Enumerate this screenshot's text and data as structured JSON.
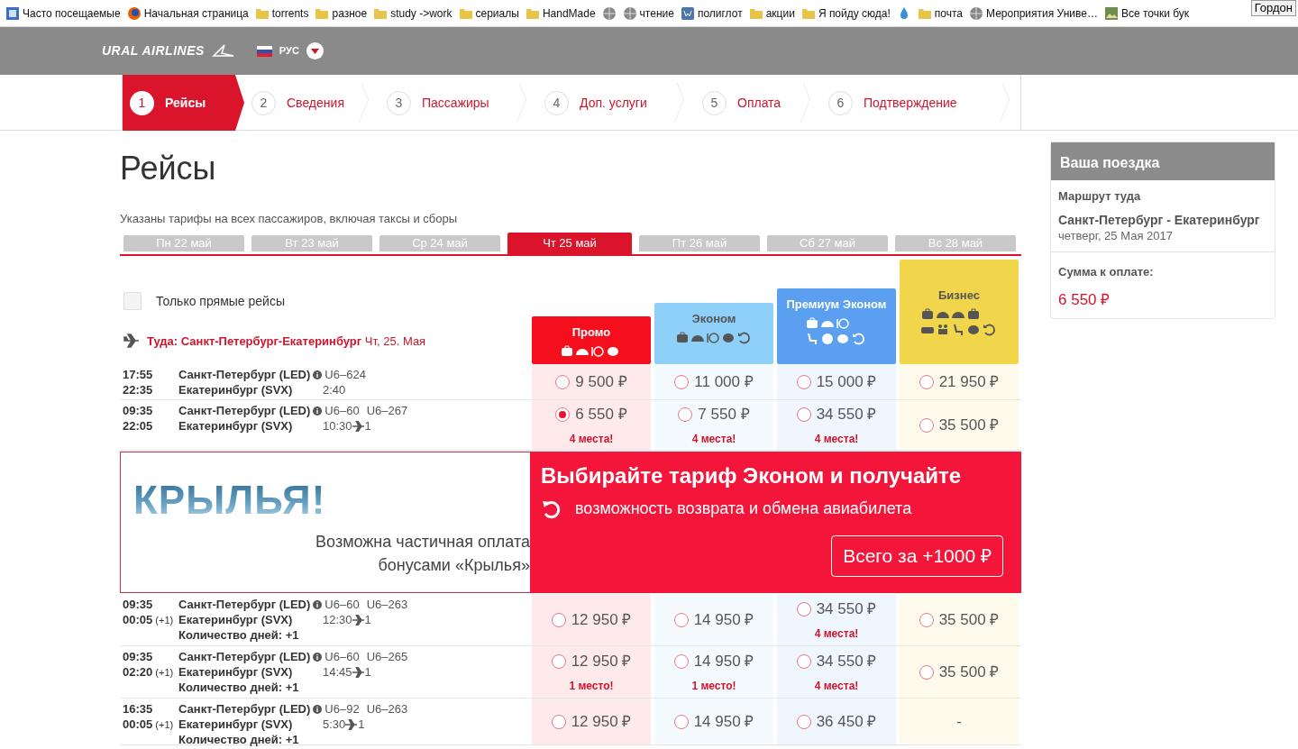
{
  "bookmarks": [
    {
      "kind": "page",
      "label": "Часто посещаемые"
    },
    {
      "kind": "firefox",
      "label": "Начальная страница"
    },
    {
      "kind": "folder",
      "label": "torrents"
    },
    {
      "kind": "folder",
      "label": "разное"
    },
    {
      "kind": "folder",
      "label": "study ->work"
    },
    {
      "kind": "folder",
      "label": "сериалы"
    },
    {
      "kind": "folder",
      "label": "HandMade"
    },
    {
      "kind": "globe"
    },
    {
      "kind": "globe",
      "label": "чтение"
    },
    {
      "kind": "vk",
      "label": "полиглот"
    },
    {
      "kind": "folder",
      "label": "акции"
    },
    {
      "kind": "folder",
      "label": "Я пойду сюда!"
    },
    {
      "kind": "drop"
    },
    {
      "kind": "folder",
      "label": "почта"
    },
    {
      "kind": "globe",
      "label": "Мероприятия Униве…"
    },
    {
      "kind": "image",
      "label": "Все точки бук"
    }
  ],
  "tooltip": "Гордон",
  "header": {
    "logo": "URAL AIRLINES",
    "language": "РУС"
  },
  "steps": [
    {
      "number": "1",
      "label": "Рейсы",
      "selected": true
    },
    {
      "number": "2",
      "label": "Сведения",
      "selected": false
    },
    {
      "number": "3",
      "label": "Пассажиры",
      "selected": false
    },
    {
      "number": "4",
      "label": "Доп. услуги",
      "selected": false
    },
    {
      "number": "5",
      "label": "Оплата",
      "selected": false
    },
    {
      "number": "6",
      "label": "Подтверждение",
      "selected": false
    }
  ],
  "page_title": "Рейсы",
  "note": "Указаны тарифы на всех пассажиров, включая таксы и сборы",
  "dates": [
    {
      "label": "Пн 22 май",
      "selected": false
    },
    {
      "label": "Вт 23 май",
      "selected": false
    },
    {
      "label": "Ср 24 май",
      "selected": false
    },
    {
      "label": "Чт 25 май",
      "selected": true
    },
    {
      "label": "Пт 26 май",
      "selected": false
    },
    {
      "label": "Сб 27 май",
      "selected": false
    },
    {
      "label": "Вс 28 май",
      "selected": false
    }
  ],
  "direct_only": {
    "label": "Только прямые рейсы",
    "checked": false
  },
  "direction": "**Туда: Санкт-Петербург-Екатеринбург** Чт, 25. Мая",
  "fares": [
    {
      "name": "Промо",
      "color": "#f50f1c"
    },
    {
      "name": "Эконом",
      "color": "#8fd0f8"
    },
    {
      "name": "Премиум Эконом",
      "color": "#5a9ff0"
    },
    {
      "name": "Бизнес",
      "color": "#f1d54a"
    }
  ],
  "results": [
    {
      "kind": "flight",
      "depart": "17:55",
      "arrive": "22:35",
      "from": "Санкт-Петербург (LED)",
      "to": "Екатеринбург (SVX)",
      "numbers": [
        "U6–624"
      ],
      "duration": "2:40",
      "fares": [
        {
          "kind": "fare",
          "price": "9 500 ₽",
          "selected": false
        },
        {
          "kind": "fare",
          "price": "11 000 ₽",
          "selected": false
        },
        {
          "kind": "fare",
          "price": "15 000 ₽",
          "selected": false
        },
        {
          "kind": "fare",
          "price": "21 950 ₽",
          "selected": false
        }
      ]
    },
    {
      "kind": "flight",
      "depart": "09:35",
      "arrive": "22:05",
      "from": "Санкт-Петербург (LED)",
      "to": "Екатеринбург (SVX)",
      "numbers": [
        "U6–60",
        "U6–267"
      ],
      "duration": "10:30",
      "stops": "1",
      "fares": [
        {
          "kind": "fare",
          "price": "6 550 ₽",
          "selected": true,
          "seats": "4 места!"
        },
        {
          "kind": "fare",
          "price": "7 550 ₽",
          "selected": false,
          "seats": "4 места!"
        },
        {
          "kind": "fare",
          "price": "34 550 ₽",
          "selected": false,
          "seats": "4 места!"
        },
        {
          "kind": "fare",
          "price": "35 500 ₽",
          "selected": false
        }
      ]
    },
    {
      "kind": "promo",
      "logo": "КРЫЛЬЯ!",
      "text": "Возможна частичная оплата бонусами «Крылья»",
      "title": "Выбирайте тариф Эконом и получайте",
      "subtitle": "возможность возврата и обмена авиабилета",
      "button": "Всего за +1000 ₽"
    },
    {
      "kind": "flight",
      "depart": "09:35",
      "arrive": "00:05",
      "next_day": "(+1)",
      "from": "Санкт-Петербург (LED)",
      "to": "Екатеринбург (SVX)",
      "numbers": [
        "U6–60",
        "U6–263"
      ],
      "duration": "12:30",
      "stops": "1",
      "days": "Количество дней: +1",
      "fares": [
        {
          "kind": "fare",
          "price": "12 950 ₽",
          "selected": false
        },
        {
          "kind": "fare",
          "price": "14 950 ₽",
          "selected": false
        },
        {
          "kind": "fare",
          "price": "34 550 ₽",
          "selected": false,
          "seats": "4 места!"
        },
        {
          "kind": "fare",
          "price": "35 500 ₽",
          "selected": false
        }
      ]
    },
    {
      "kind": "flight",
      "depart": "09:35",
      "arrive": "02:20",
      "next_day": "(+1)",
      "from": "Санкт-Петербург (LED)",
      "to": "Екатеринбург (SVX)",
      "numbers": [
        "U6–60",
        "U6–265"
      ],
      "duration": "14:45",
      "stops": "1",
      "days": "Количество дней: +1",
      "fares": [
        {
          "kind": "fare",
          "price": "12 950 ₽",
          "selected": false,
          "seats": "1 место!"
        },
        {
          "kind": "fare",
          "price": "14 950 ₽",
          "selected": false,
          "seats": "1 место!"
        },
        {
          "kind": "fare",
          "price": "34 550 ₽",
          "selected": false,
          "seats": "4 места!"
        },
        {
          "kind": "fare",
          "price": "35 500 ₽",
          "selected": false
        }
      ]
    },
    {
      "kind": "flight",
      "depart": "16:35",
      "arrive": "00:05",
      "next_day": "(+1)",
      "from": "Санкт-Петербург (LED)",
      "to": "Екатеринбург (SVX)",
      "numbers": [
        "U6–92",
        "U6–263"
      ],
      "duration": "5:30",
      "stops": "1",
      "days": "Количество дней: +1",
      "fares": [
        {
          "kind": "fare",
          "price": "12 950 ₽",
          "selected": false
        },
        {
          "kind": "fare",
          "price": "14 950 ₽",
          "selected": false
        },
        {
          "kind": "fare",
          "price": "36 450 ₽",
          "selected": false
        },
        {
          "kind": "dash",
          "text": "-"
        }
      ]
    }
  ],
  "trip": {
    "title": "Ваша поездка",
    "route_label": "Маршрут туда",
    "route": "Санкт-Петербург - Екатеринбург",
    "date": "четверг, 25 Мая 2017",
    "total_label": "Сумма к оплате:",
    "total": "6 550 ₽"
  }
}
